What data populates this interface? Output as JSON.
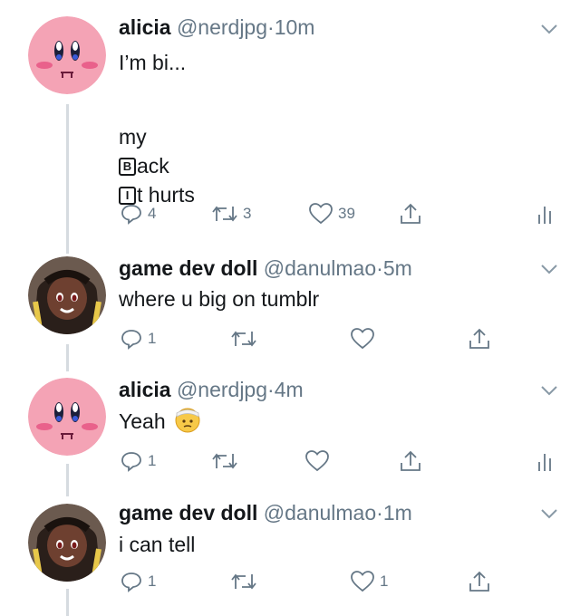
{
  "tweets": [
    {
      "name": "alicia",
      "handle": "@nerdjpg",
      "separator": "·",
      "time": "10m",
      "lines": [
        "I’m bi...",
        "",
        "my",
        "ack",
        "t hurts"
      ],
      "boxed_letters": [
        "B",
        "I"
      ],
      "replies": "4",
      "retweets": "3",
      "likes": "39",
      "avatar": "kirby-avatar"
    },
    {
      "name": "game dev doll",
      "handle": "@danulmao",
      "separator": "·",
      "time": "5m",
      "lines": [
        "where u big on tumblr"
      ],
      "replies": "1",
      "retweets": "",
      "likes": "",
      "avatar": "game-dev-doll-avatar"
    },
    {
      "name": "alicia",
      "handle": "@nerdjpg",
      "separator": "·",
      "time": "4m",
      "lines": [
        "Yeah"
      ],
      "emoji": "face-with-head-bandage",
      "replies": "1",
      "retweets": "",
      "likes": "",
      "avatar": "kirby-avatar"
    },
    {
      "name": "game dev doll",
      "handle": "@danulmao",
      "separator": "·",
      "time": "1m",
      "lines": [
        "i can tell"
      ],
      "replies": "1",
      "retweets": "",
      "likes": "1",
      "avatar": "game-dev-doll-avatar"
    }
  ],
  "icons": {
    "reply": "reply-icon",
    "retweet": "retweet-icon",
    "like": "heart-icon",
    "share": "share-icon",
    "analytics": "analytics-icon",
    "caret": "chevron-down-icon"
  },
  "colors": {
    "text": "#14171a",
    "secondary": "#657786",
    "thread_line": "#d6dbe0",
    "kirby_pink": "#f4a3b5"
  }
}
